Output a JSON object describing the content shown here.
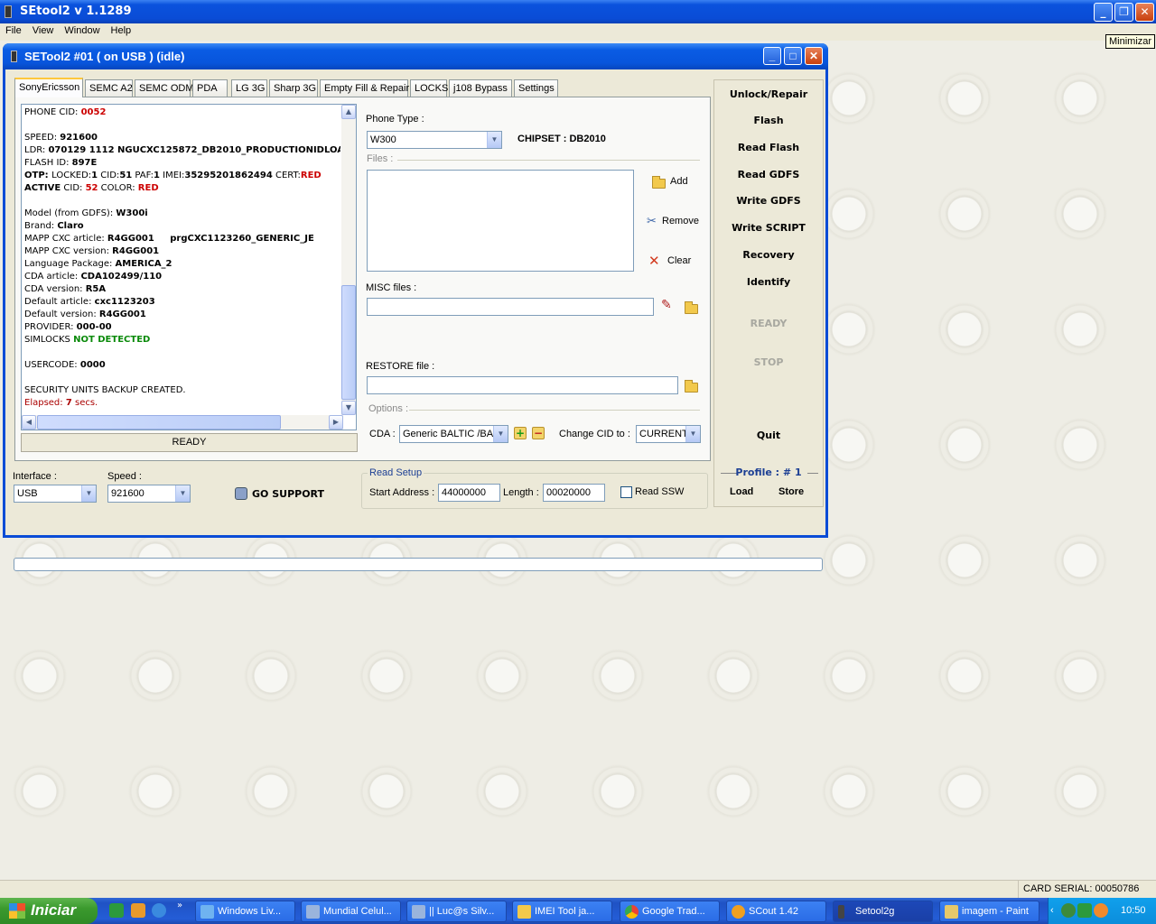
{
  "app": {
    "title": "SEtool2 v 1.1289",
    "menu": [
      "File",
      "View",
      "Window",
      "Help"
    ],
    "tooltip": "Minimizar"
  },
  "window": {
    "title": "SETool2 #01 ( on USB ) (idle)",
    "tabs": [
      "SonyEricsson",
      "SEMC A2",
      "SEMC ODM",
      "PDA",
      "LG 3G",
      "Sharp 3G",
      "Empty Fill & Repair",
      "LOCKS",
      "j108 Bypass",
      "Settings"
    ],
    "active_tab": "SonyEricsson"
  },
  "log": {
    "phone_cid_label": "PHONE CID: ",
    "phone_cid": "0052",
    "speed_label": "SPEED: ",
    "speed": "921600",
    "ldr_label": "LDR: ",
    "ldr": "070129 1112 NGUCXC125872_DB2010_PRODUCTIONIDLOA",
    "flash_label": "FLASH ID: ",
    "flash": "897E",
    "otp_label": "OTP: ",
    "otp_locked_label": "LOCKED:",
    "otp_locked": "1",
    "otp_cid_label": " CID:",
    "otp_cid": "51",
    "otp_paf_label": " PAF:",
    "otp_paf": "1",
    "otp_imei_label": " IMEI:",
    "otp_imei": "35295201862494",
    "otp_cert_label": " CERT:",
    "otp_cert": "RED",
    "active_label": "ACTIVE",
    "active_cid_label": " CID: ",
    "active_cid": "52",
    "active_color_label": " COLOR: ",
    "active_color": "RED",
    "model_label": "Model (from GDFS): ",
    "model": "W300i",
    "brand_label": "Brand: ",
    "brand": "Claro",
    "mapp_article_label": "MAPP CXC article: ",
    "mapp_article": "R4GG001     prgCXC1123260_GENERIC_JE",
    "mapp_version_label": "MAPP CXC version: ",
    "mapp_version": "R4GG001",
    "lang_label": "Language Package: ",
    "lang": "AMERICA_2",
    "cda_article_label": "CDA article: ",
    "cda_article": "CDA102499/110",
    "cda_version_label": "CDA version: ",
    "cda_version": "R5A",
    "def_article_label": "Default article: ",
    "def_article": "cxc1123203",
    "def_version_label": "Default version: ",
    "def_version": "R4GG001",
    "provider_label": "PROVIDER: ",
    "provider": "000-00",
    "simlocks_label": "SIMLOCKS ",
    "simlocks": "NOT DETECTED",
    "usercode_label": "USERCODE: ",
    "usercode": "0000",
    "backup": "SECURITY UNITS BACKUP CREATED.",
    "elapsed_label": "Elapsed: ",
    "elapsed_value": "7",
    "elapsed_unit": " secs."
  },
  "log_status": "READY",
  "phone": {
    "type_label": "Phone Type :",
    "type_value": "W300",
    "chipset": "CHIPSET : DB2010",
    "files_label": "Files :",
    "add": "Add",
    "remove": "Remove",
    "clear": "Clear",
    "misc_label": "MISC files :",
    "misc_value": "",
    "restore_label": "RESTORE file :",
    "restore_value": "",
    "options_label": "Options :",
    "cda_label": "CDA :",
    "cda_value": "Generic BALTIC   /BA",
    "change_cid_label": "Change CID to :",
    "change_cid_value": "CURRENT"
  },
  "side": {
    "buttons": [
      "Unlock/Repair",
      "Flash",
      "Read Flash",
      "Read GDFS",
      "Write GDFS",
      "Write SCRIPT",
      "Recovery",
      "Identify"
    ],
    "ready": "READY",
    "stop": "STOP",
    "quit": "Quit",
    "profile": "Profile :  # 1",
    "load": "Load",
    "store": "Store"
  },
  "bottom": {
    "interface_label": "Interface :",
    "interface_value": "USB",
    "speed_label": "Speed :",
    "speed_value": "921600",
    "go_support": "GO SUPPORT",
    "read_setup": "Read Setup",
    "start_label": "Start Address :",
    "start_value": "44000000",
    "length_label": "Length :",
    "length_value": "00020000",
    "read_ssw": "Read SSW",
    "read_ssw_checked": false
  },
  "statusbar": {
    "card_serial": "CARD SERIAL: 00050786"
  },
  "taskbar": {
    "start": "Iniciar",
    "items": [
      "Windows Liv...",
      "Mundial Celul...",
      "|| Luc@s Silv...",
      "IMEI Tool ja...",
      "Google Trad...",
      "SCout 1.42",
      "Setool2g",
      "imagem - Paint"
    ],
    "active_item": "Setool2g",
    "time": "10:50"
  },
  "colors": {
    "xp_blue": "#0a4cd6",
    "log_red": "#cc0000",
    "log_green": "#0a8a0a",
    "button_face": "#ece9d8"
  }
}
